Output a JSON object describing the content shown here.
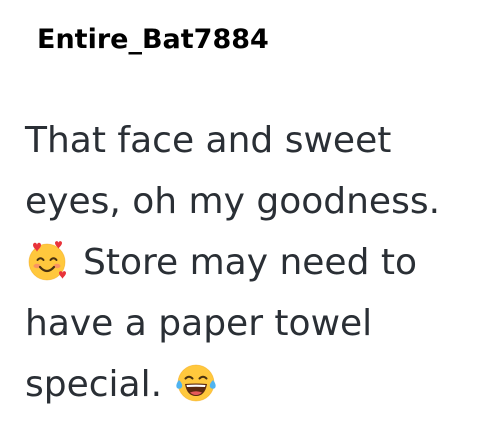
{
  "comment": {
    "username": "Entire_Bat7884",
    "lines": [
      "That face and sweet",
      "eyes, oh my goodness.",
      "Store may need to",
      "have a paper towel",
      "special."
    ],
    "emojis": {
      "hearts_face": "smiling-face-with-hearts-icon",
      "joy_face": "face-with-tears-of-joy-icon"
    }
  }
}
